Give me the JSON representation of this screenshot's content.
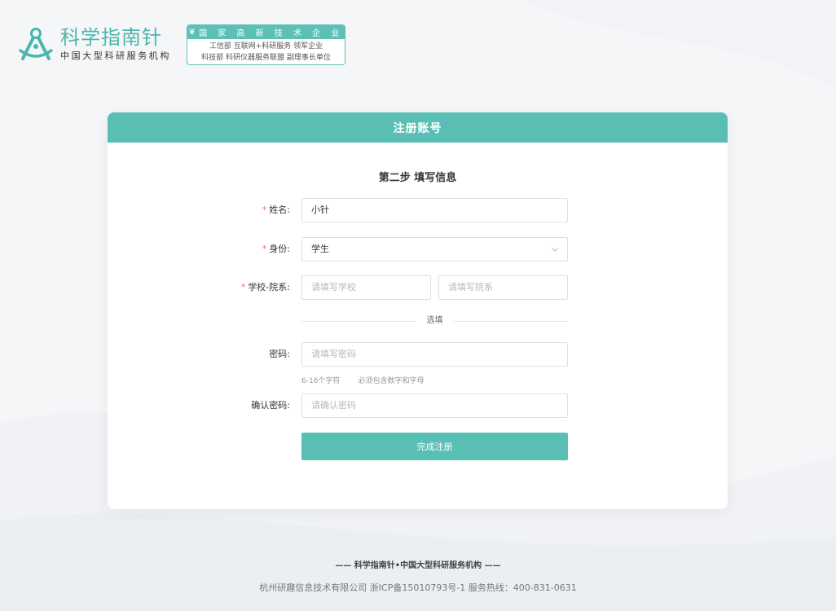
{
  "brand": {
    "name": "科学指南针",
    "subtitle": "中国大型科研服务机构",
    "badge_title": "国 家 高 新 技 术 企 业",
    "badge_line1": "工信部 互联网+科研服务 领军企业",
    "badge_line2": "科技部 科研仪器服务联盟 副理事长单位"
  },
  "card": {
    "header": "注册账号",
    "step_title": "第二步 填写信息"
  },
  "form": {
    "name_label": "姓名:",
    "name_value": "小针",
    "identity_label": "身份:",
    "identity_value": "学生",
    "school_label": "学校-院系:",
    "school_placeholder": "请填写学校",
    "dept_placeholder": "请填写院系",
    "optional_divider": "选填",
    "password_label": "密码:",
    "password_placeholder": "请填写密码",
    "password_hint_length": "6-16个字符",
    "password_hint_rule": "必须包含数字和字母",
    "confirm_label": "确认密码:",
    "confirm_placeholder": "请确认密码",
    "required_mark": "*",
    "submit_label": "完成注册"
  },
  "footer": {
    "title": "—— 科学指南针•中国大型科研服务机构 ——",
    "info": "杭州研趣信息技术有限公司 浙ICP备15010793号-1 服务热线：400-831-0631"
  },
  "colors": {
    "accent": "#59bfb4",
    "required": "#f56c6c",
    "background": "#f4f6f8"
  },
  "icons": {
    "logo": "compass-logo-icon",
    "badge_leaf": "leaf-icon",
    "select_arrow": "chevron-down-icon"
  }
}
